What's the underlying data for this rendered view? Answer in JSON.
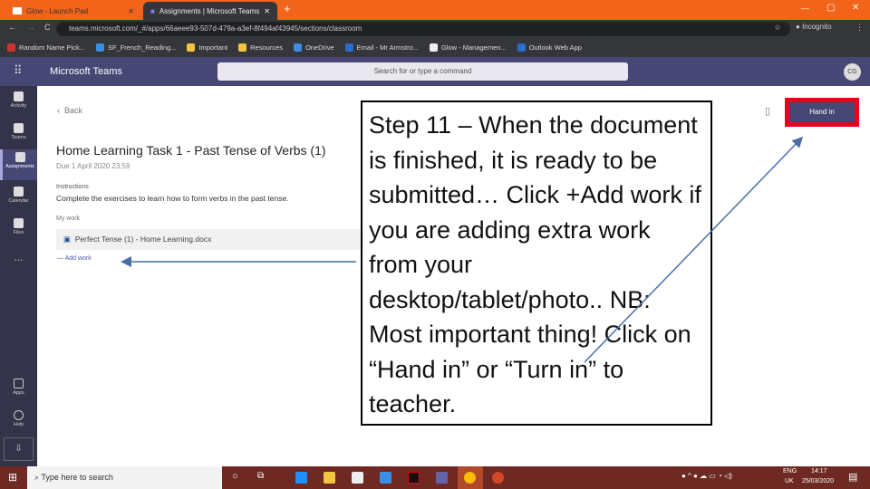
{
  "browser": {
    "tabs": [
      {
        "label": "Glow - Launch Pad",
        "active": false
      },
      {
        "label": "Assignments | Microsoft Teams",
        "active": true
      }
    ],
    "url": "teams.microsoft.com/_#/apps/66aeee93-507d-479a-a3ef-8f494af43945/sections/classroom",
    "profile": "Incognito",
    "bookmarks": [
      "Random Name Pick...",
      "SF_French_Reading...",
      "Important",
      "Resources",
      "OneDrive",
      "Email - Mr Armstro...",
      "Glow - Managemen...",
      "Outlook Web App"
    ]
  },
  "teams": {
    "app_title": "Microsoft Teams",
    "search_placeholder": "Search for or type a command",
    "avatar_initials": "CG",
    "rail": [
      "Activity",
      "Teams",
      "Assignments",
      "Calendar",
      "Files",
      "...",
      "Apps",
      "Help"
    ],
    "back_label": "Back",
    "assignment_title": "Home Learning Task 1 - Past Tense of Verbs (1)",
    "due": "Due 1 April 2020 23:59",
    "instructions_label": "Instructions",
    "instructions": "Complete the exercises to learn how to form verbs in the past tense.",
    "my_work_label": "My work",
    "file_name": "Perfect Tense (1) - Home Learning.docx",
    "add_work": "Add work",
    "hand_in": "Hand in"
  },
  "callout": {
    "text": "Step 11 – When the document is finished, it is ready to be submitted… Click +Add work if you are adding extra work from your desktop/tablet/photo.. NB: Most important thing! Click on “Hand in” or “Turn in” to teacher."
  },
  "taskbar": {
    "search_placeholder": "Type here to search",
    "language": "ENG",
    "region": "UK",
    "time": "14:17",
    "date": "25/03/2020"
  },
  "colors": {
    "chrome_orange": "#f26419",
    "teams_purple": "#464775",
    "highlight_red": "#e8001c",
    "arrow": "#4a6fa5"
  }
}
